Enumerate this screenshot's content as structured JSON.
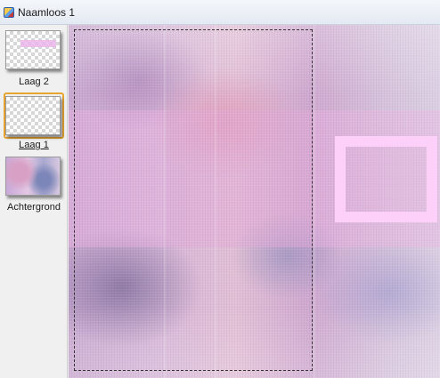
{
  "window": {
    "title": "Naamloos 1"
  },
  "layers_panel": {
    "layers": [
      {
        "name": "Laag 2",
        "thumbnail": "transparent-with-pink-strip",
        "selected": false
      },
      {
        "name": "Laag 1",
        "thumbnail": "transparent",
        "selected": true
      },
      {
        "name": "Achtergrond",
        "thumbnail": "pastel-blurred-image",
        "selected": false
      }
    ]
  },
  "colors": {
    "selection_highlight": "#e8a530",
    "frame_pink": "#fcd0f8",
    "canvas_base": "#d7b6d8"
  }
}
